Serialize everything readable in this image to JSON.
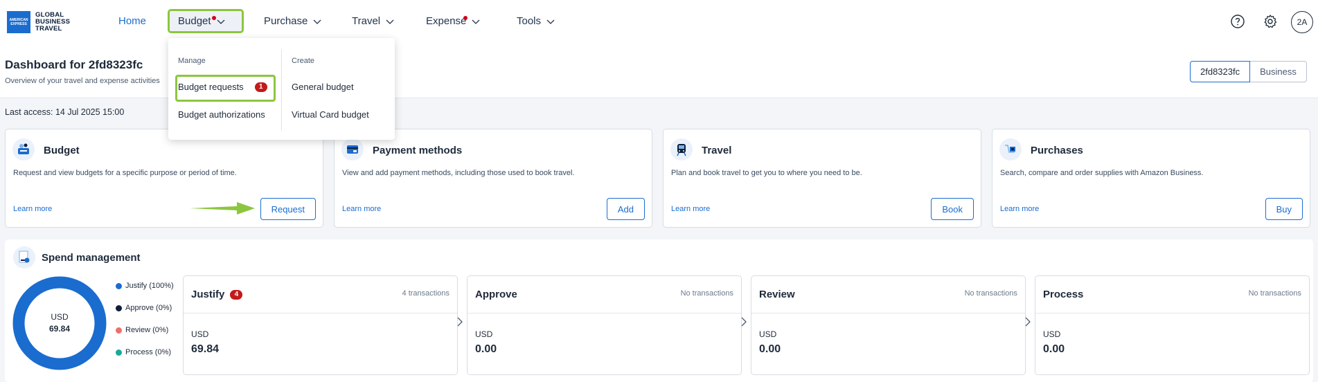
{
  "header": {
    "logo_lines": [
      "AMERICAN EXPRESS",
      "GLOBAL",
      "BUSINESS",
      "TRAVEL"
    ],
    "nav": [
      {
        "label": "Home",
        "active": true
      },
      {
        "label": "Budget",
        "dot": true
      },
      {
        "label": "Purchase"
      },
      {
        "label": "Travel"
      },
      {
        "label": "Expense",
        "dot": true
      },
      {
        "label": "Tools"
      }
    ],
    "avatar": "2A",
    "icons": [
      "help-icon",
      "gear-icon"
    ]
  },
  "budget_menu": {
    "manage_heading": "Manage",
    "create_heading": "Create",
    "manage_items": [
      {
        "label": "Budget requests",
        "badge": "1"
      },
      {
        "label": "Budget authorizations"
      }
    ],
    "create_items": [
      {
        "label": "General budget"
      },
      {
        "label": "Virtual Card budget"
      }
    ]
  },
  "dashboard": {
    "title": "Dashboard for 2fd8323fc",
    "subtitle": "Overview of your travel and expense activities",
    "profile_toggle": [
      "2fd8323fc",
      "Business"
    ],
    "last_access": "Last access: 14 Jul 2025 15:00"
  },
  "cards": [
    {
      "title": "Budget",
      "desc": "Request and view budgets for a specific purpose or period of time.",
      "link": "Learn more",
      "button": "Request",
      "icon": "budget-icon"
    },
    {
      "title": "Payment methods",
      "desc": "View and add payment methods, including those used to book travel.",
      "link": "Learn more",
      "button": "Add",
      "icon": "wallet-icon"
    },
    {
      "title": "Travel",
      "desc": "Plan and book travel to get you to where you need to be.",
      "link": "Learn more",
      "button": "Book",
      "icon": "train-icon"
    },
    {
      "title": "Purchases",
      "desc": "Search, compare and order supplies with Amazon Business.",
      "link": "Learn more",
      "button": "Buy",
      "icon": "shopping-icon"
    }
  ],
  "spend": {
    "title": "Spend management",
    "donut_currency": "USD",
    "donut_total": "69.84",
    "legend": [
      {
        "label": "Justify (100%)",
        "color": "#1a6ccf"
      },
      {
        "label": "Approve (0%)",
        "color": "#0b1f3a"
      },
      {
        "label": "Review (0%)",
        "color": "#ef6f6c"
      },
      {
        "label": "Process (0%)",
        "color": "#1aa89a"
      }
    ],
    "stages": [
      {
        "title": "Justify",
        "badge": "4",
        "count": "4 transactions",
        "currency": "USD",
        "amount": "69.84"
      },
      {
        "title": "Approve",
        "count": "No transactions",
        "currency": "USD",
        "amount": "0.00"
      },
      {
        "title": "Review",
        "count": "No transactions",
        "currency": "USD",
        "amount": "0.00"
      },
      {
        "title": "Process",
        "count": "No transactions",
        "currency": "USD",
        "amount": "0.00"
      }
    ]
  },
  "colors": {
    "accent": "#1a6ccf",
    "highlight": "#8cc63f",
    "badge": "#c41a1a"
  }
}
